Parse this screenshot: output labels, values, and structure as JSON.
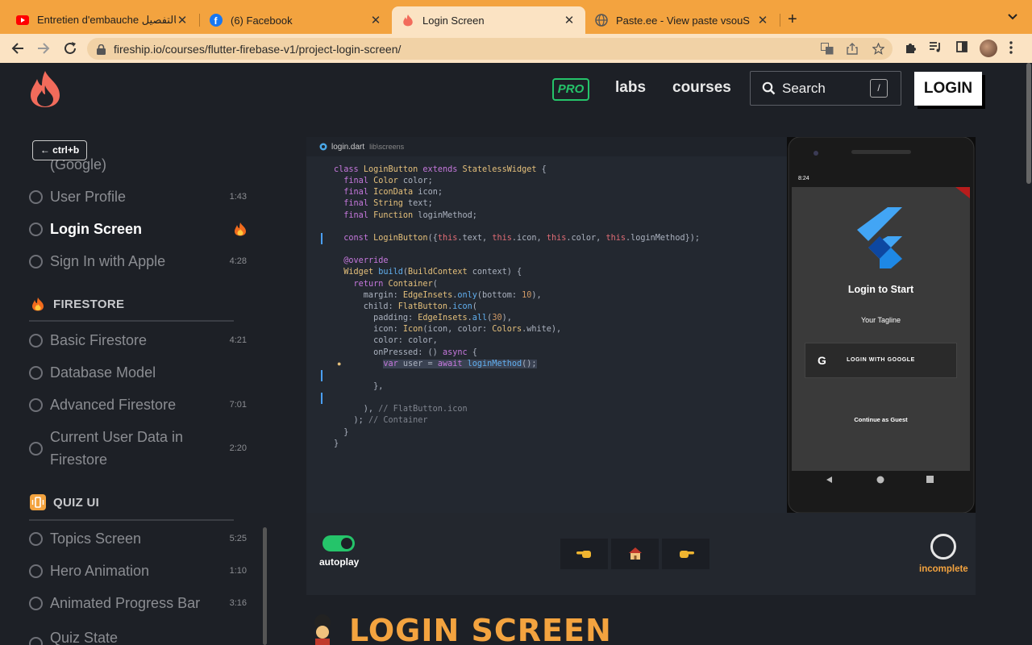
{
  "browser": {
    "tabs": [
      {
        "title": "Entretien d'embauche بالتفصيل",
        "icon": "youtube-icon"
      },
      {
        "title": "(6) Facebook",
        "icon": "facebook-icon"
      },
      {
        "title": "Login Screen",
        "icon": "fireship-icon"
      },
      {
        "title": "Paste.ee - View paste vsouS",
        "icon": "globe-icon"
      }
    ],
    "new_tab": "+",
    "tab_close": "✕",
    "url": "fireship.io/courses/flutter-firebase-v1/project-login-screen/"
  },
  "header": {
    "pro": "PRO",
    "labs": "labs",
    "courses": "courses",
    "search_label": "Search",
    "search_key": "/",
    "login": "LOGIN"
  },
  "sidebar": {
    "ctrlb": "← ctrl+b",
    "partial_item": "(Google)",
    "lessons_top": [
      {
        "name": "User Profile",
        "duration": "1:43"
      },
      {
        "name": "Login Screen",
        "duration": "",
        "current": true
      },
      {
        "name": "Sign In with Apple",
        "duration": "4:28"
      }
    ],
    "section_firestore": "FIRESTORE",
    "lessons_firestore": [
      {
        "name": "Basic Firestore",
        "duration": "4:21"
      },
      {
        "name": "Database Model",
        "duration": ""
      },
      {
        "name": "Advanced Firestore",
        "duration": "7:01"
      },
      {
        "name": "Current User Data in Firestore",
        "duration": "2:20"
      }
    ],
    "section_quiz": "QUIZ UI",
    "lessons_quiz": [
      {
        "name": "Topics Screen",
        "duration": "5:25"
      },
      {
        "name": "Hero Animation",
        "duration": "1:10"
      },
      {
        "name": "Animated Progress Bar",
        "duration": "3:16"
      },
      {
        "name": "Quiz State",
        "duration": ""
      }
    ]
  },
  "editor": {
    "filename": "login.dart",
    "path": "lib\\screens"
  },
  "phone": {
    "time": "8:24",
    "title": "Login to Start",
    "tagline": "Your Tagline",
    "google_button": "LOGIN WITH GOOGLE",
    "google_letter": "G",
    "guest": "Continue as Guest"
  },
  "controls": {
    "autoplay": "autoplay",
    "status": "incomplete",
    "autoplay_on": true
  },
  "lesson_title": "LOGIN SCREEN",
  "colors": {
    "accent_orange": "#f3a33f",
    "accent_green": "#25c46a",
    "background": "#1d2026"
  }
}
